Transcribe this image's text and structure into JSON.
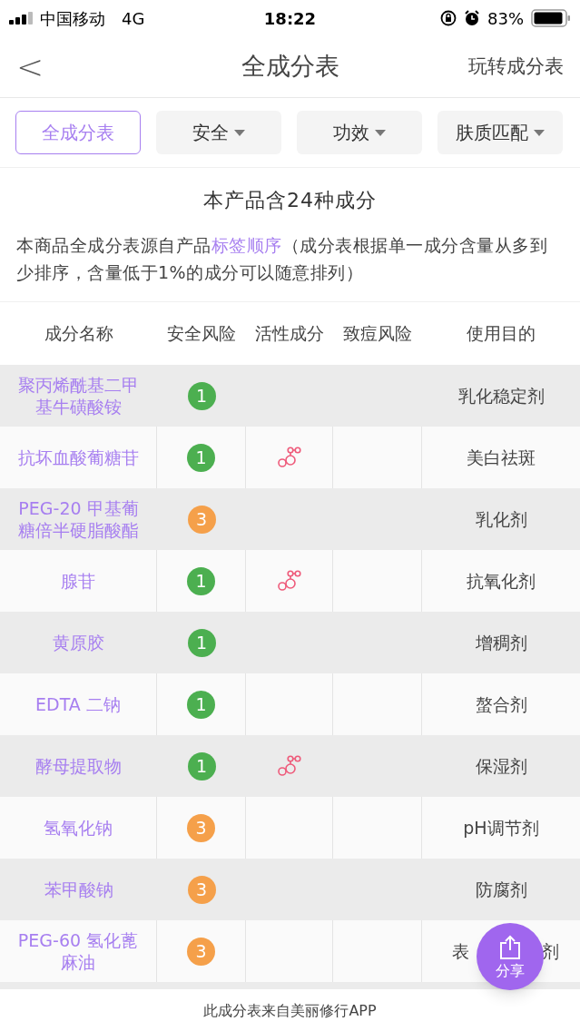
{
  "status_bar": {
    "carrier": "中国移动",
    "network": "4G",
    "time": "18:22",
    "battery": "83%"
  },
  "nav": {
    "back": "<",
    "title": "全成分表",
    "action": "玩转成分表"
  },
  "filters": [
    {
      "label": "全成分表",
      "selected": true,
      "dropdown": false
    },
    {
      "label": "安全",
      "selected": false,
      "dropdown": true
    },
    {
      "label": "功效",
      "selected": false,
      "dropdown": true
    },
    {
      "label": "肤质匹配",
      "selected": false,
      "dropdown": true
    }
  ],
  "summary": "本产品含24种成分",
  "description": "本商品全成分表源自产品",
  "description_link": "标签顺序",
  "description_rest": "（成分表根据单一成分含量从多到少排序，含量低于1%的成分可以随意排列）",
  "table": {
    "columns": [
      "成分名称",
      "安全风险",
      "活性成分",
      "致痘风险",
      "使用目的"
    ],
    "rows": [
      {
        "name": "聚丙烯酰基二甲基牛磺酸铵",
        "risk": "1",
        "active": false,
        "purpose": "乳化稳定剂"
      },
      {
        "name": "抗坏血酸葡糖苷",
        "risk": "1",
        "active": true,
        "purpose": "美白祛斑"
      },
      {
        "name": "PEG-20 甲基葡糖倍半硬脂酸酯",
        "risk": "3",
        "active": false,
        "purpose": "乳化剂"
      },
      {
        "name": "腺苷",
        "risk": "1",
        "active": true,
        "purpose": "抗氧化剂"
      },
      {
        "name": "黄原胶",
        "risk": "1",
        "active": false,
        "purpose": "增稠剂"
      },
      {
        "name": "EDTA 二钠",
        "risk": "1",
        "active": false,
        "purpose": "螯合剂"
      },
      {
        "name": "酵母提取物",
        "risk": "1",
        "active": true,
        "purpose": "保湿剂"
      },
      {
        "name": "氢氧化钠",
        "risk": "3",
        "active": false,
        "purpose": "pH调节剂"
      },
      {
        "name": "苯甲酸钠",
        "risk": "3",
        "active": false,
        "purpose": "防腐剂"
      },
      {
        "name": "PEG-60 氢化蓖麻油",
        "risk": "3",
        "active": false,
        "purpose": "表",
        "purpose_tail": "剂"
      }
    ]
  },
  "share": {
    "label": "分享"
  },
  "footer": "此成分表来自美丽修行APP"
}
